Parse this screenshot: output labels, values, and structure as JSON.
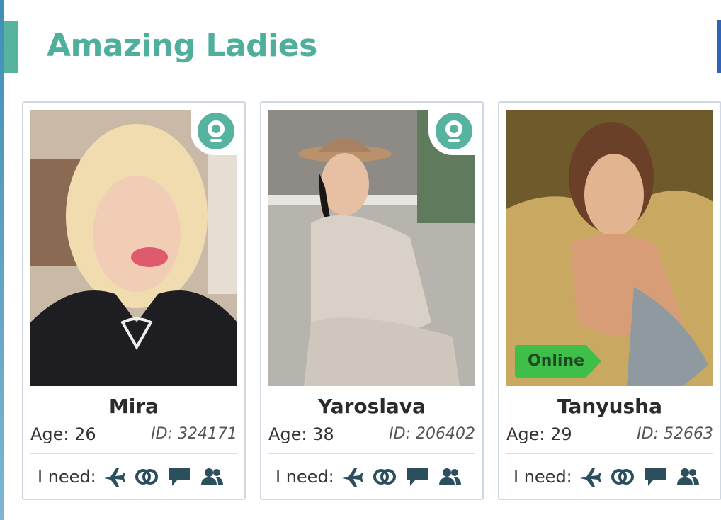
{
  "section": {
    "title": "Amazing Ladies"
  },
  "colors": {
    "accent": "#56b3a0",
    "title": "#4faf9c",
    "icon": "#2b4f5c",
    "online": "#3fbf4a"
  },
  "cards": [
    {
      "name": "Mira",
      "age": "Age: 26",
      "id": "ID: 324171",
      "need_label": "I need:",
      "webcam": true,
      "online": false,
      "needs": [
        "travel-icon",
        "rings-icon",
        "chat-icon",
        "friends-icon"
      ]
    },
    {
      "name": "Yaroslava",
      "age": "Age: 38",
      "id": "ID: 206402",
      "need_label": "I need:",
      "webcam": true,
      "online": false,
      "needs": [
        "travel-icon",
        "rings-icon",
        "chat-icon",
        "friends-icon"
      ]
    },
    {
      "name": "Tanyusha",
      "age": "Age: 29",
      "id": "ID: 52663",
      "need_label": "I need:",
      "webcam": false,
      "online": true,
      "online_label": "Online",
      "needs": [
        "travel-icon",
        "rings-icon",
        "chat-icon",
        "friends-icon"
      ]
    }
  ]
}
